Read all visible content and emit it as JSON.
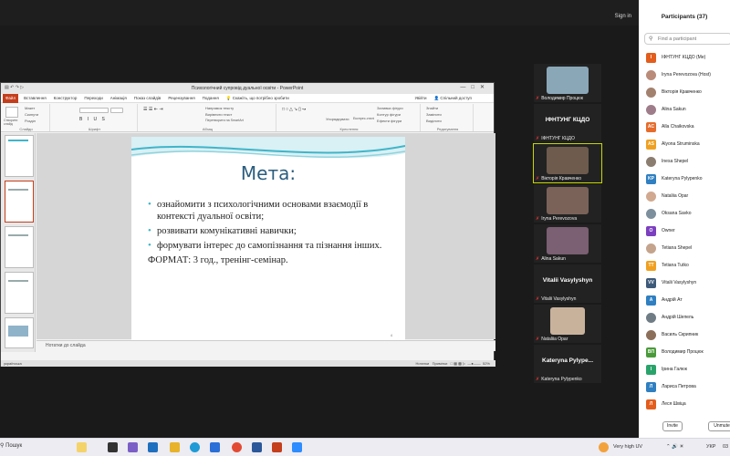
{
  "zoom": {
    "sign_in": "Sign in"
  },
  "powerpoint": {
    "window_title": "Психологічний супровід дуальної освіти - PowerPoint",
    "menu": [
      "Файл",
      "Вставлення",
      "Конструктор",
      "Переходи",
      "Анімація",
      "Показ слайдів",
      "Рецензування",
      "Подання"
    ],
    "tell_me": "Скажіть, що потрібно зробити",
    "sign_in_label": "Увійти",
    "share_label": "Спільний доступ",
    "ribbon_groups": [
      "Слайди",
      "Шрифт",
      "Абзац",
      "Креслення",
      "Редагування"
    ],
    "ribbon_items": {
      "new_slide": "Створити слайд",
      "layout": "Макет",
      "reset": "Скинути",
      "section": "Розділ",
      "text_direction": "Напрямок тексту",
      "align_text": "Вирівняти текст",
      "smartart": "Перетворити на SmartArt",
      "arrange": "Упорядкувати",
      "quick_styles": "Експрес-стилі",
      "shape_fill": "Заливка фігури",
      "shape_outline": "Контур фігури",
      "shape_effects": "Ефекти фігури",
      "find": "Знайти",
      "replace": "Замінити",
      "select": "Виділити"
    },
    "slide": {
      "title": "Мета:",
      "bullets": [
        "ознайомити з психологічними основами взаємодії в контексті дуальної освіти;",
        "розвивати комунікативні навички;",
        "формувати інтерес до самопізнання та пізнання інших."
      ],
      "format_line": "ФОРМАТ: 3 год., тренінг-семінар.",
      "number": "4"
    },
    "notes_placeholder": "Нотатки до слайда",
    "status": {
      "language": "українська",
      "notes": "Нотатки",
      "comments": "Примітки",
      "zoom": "52%"
    }
  },
  "video_tiles": [
    {
      "name": "Володимир Процюк",
      "kind": "photo",
      "color": "#8aa7b8"
    },
    {
      "name": "ІФНТУНГ КЦДО",
      "kind": "text",
      "big": "ІФНТУНГ КЦДО"
    },
    {
      "name": "Вікторія Кравченко",
      "kind": "photo",
      "color": "#6e5b4e",
      "active": true
    },
    {
      "name": "Iryna Perevozova",
      "kind": "photo",
      "color": "#7a6258"
    },
    {
      "name": "Alina Sakun",
      "kind": "photo",
      "color": "#7b5f73"
    },
    {
      "name": "Vitalii Vasylyshyn",
      "kind": "text",
      "big": "Vitalii Vasylyshyn"
    },
    {
      "name": "Nataliia Opar",
      "kind": "photo",
      "color": "#c9b29c"
    },
    {
      "name": "Kateryna Pylypenko",
      "kind": "text",
      "big": "Kateryna  Pylype..."
    }
  ],
  "participants_panel": {
    "title": "Participants (37)",
    "search_placeholder": "Find a participant",
    "list": [
      {
        "name": "ІФНТУНГ КЦДО (Me)",
        "initials": "I",
        "color": "#e35d1c"
      },
      {
        "name": "Iryna Perevozova (Host)",
        "initials": "",
        "color": "#b98b78"
      },
      {
        "name": "Вікторія Кравченко",
        "initials": "",
        "color": "#a3816f"
      },
      {
        "name": "Alina Sakun",
        "initials": "",
        "color": "#9f7c89"
      },
      {
        "name": "Alla Chaikovska",
        "initials": "AC",
        "color": "#e66c2c"
      },
      {
        "name": "Alyona Struminska",
        "initials": "AS",
        "color": "#f0a020"
      },
      {
        "name": "Inesa Shepel",
        "initials": "",
        "color": "#8b7d70"
      },
      {
        "name": "Kateryna Pylypenko",
        "initials": "KP",
        "color": "#2f7fc1"
      },
      {
        "name": "Nataliia Opar",
        "initials": "",
        "color": "#d1a990"
      },
      {
        "name": "Oksana Savko",
        "initials": "",
        "color": "#7d8f9c"
      },
      {
        "name": "Owner",
        "initials": "O",
        "color": "#7b3fbf"
      },
      {
        "name": "Tetiana Shepel",
        "initials": "",
        "color": "#c4a48c"
      },
      {
        "name": "Tetiana Tutko",
        "initials": "TT",
        "color": "#f0a020"
      },
      {
        "name": "Vitalii Vasylyshyn",
        "initials": "VV",
        "color": "#3e5a7a"
      },
      {
        "name": "Андрій Ат",
        "initials": "А",
        "color": "#2f7fc1"
      },
      {
        "name": "Андрій Шепель",
        "initials": "",
        "color": "#6f7c86"
      },
      {
        "name": "Василь Скрипник",
        "initials": "",
        "color": "#8c6f5a"
      },
      {
        "name": "Володимир Процюк",
        "initials": "ВП",
        "color": "#4a9a3a"
      },
      {
        "name": "Ірина Галюк",
        "initials": "І",
        "color": "#2aa36b"
      },
      {
        "name": "Лариса Петрова",
        "initials": "Л",
        "color": "#2f7fc1"
      },
      {
        "name": "Леся Швіца",
        "initials": "Л",
        "color": "#e35d1c"
      }
    ],
    "invite_label": "Invite",
    "unmute_label": "Unmute"
  },
  "taskbar": {
    "search": "Пошук",
    "weather": "Very high UV",
    "language": "УКР",
    "time": "03"
  }
}
